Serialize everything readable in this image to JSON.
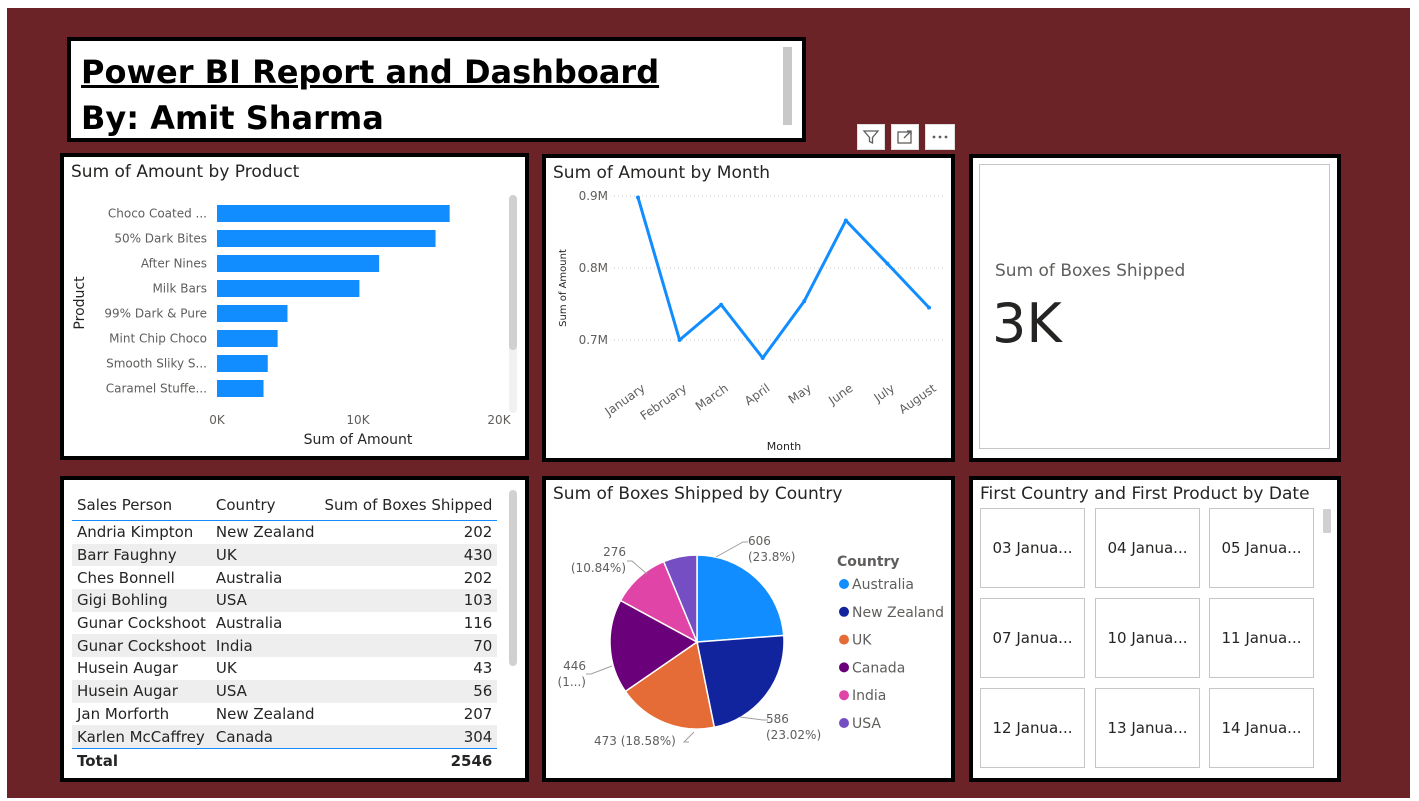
{
  "header": {
    "title_line1": "Power BI Report and Dashboard",
    "title_line2": "By: Amit Sharma"
  },
  "toolbar": {
    "icons": [
      "filter-icon",
      "focus-mode-icon",
      "more-options-icon"
    ]
  },
  "bar_chart": {
    "title": "Sum of Amount by Product",
    "chart_data": {
      "type": "bar",
      "orientation": "horizontal",
      "categories": [
        "Choco Coated ...",
        "50% Dark Bites",
        "After Nines",
        "Milk Bars",
        "99% Dark & Pure",
        "Mint Chip Choco",
        "Smooth Sliky S...",
        "Caramel Stuffe..."
      ],
      "values": [
        16500,
        15500,
        11500,
        10100,
        5000,
        4300,
        3600,
        3300
      ],
      "xlabel": "Sum of Amount",
      "ylabel": "Product",
      "xlim": [
        0,
        20000
      ],
      "xticks": [
        "0K",
        "10K",
        "20K"
      ],
      "color": "#118dff"
    }
  },
  "line_chart": {
    "title": "Sum of Amount by Month",
    "chart_data": {
      "type": "line",
      "x": [
        "January",
        "February",
        "March",
        "April",
        "May",
        "June",
        "July",
        "August"
      ],
      "values": [
        0.898,
        0.7,
        0.749,
        0.675,
        0.754,
        0.866,
        0.806,
        0.745
      ],
      "xlabel": "Month",
      "ylabel": "Sum of Amount",
      "ylim": [
        0.65,
        0.92
      ],
      "yticks": [
        {
          "v": 0.9,
          "label": "0.9M"
        },
        {
          "v": 0.8,
          "label": "0.8M"
        },
        {
          "v": 0.7,
          "label": "0.7M"
        }
      ],
      "grid": true,
      "color": "#118dff"
    }
  },
  "card": {
    "label": "Sum of Boxes Shipped",
    "value": "3K"
  },
  "table": {
    "headers": [
      "Sales Person",
      "Country",
      "Sum of Boxes Shipped"
    ],
    "rows": [
      [
        "Andria Kimpton",
        "New Zealand",
        "202"
      ],
      [
        "Barr Faughny",
        "UK",
        "430"
      ],
      [
        "Ches Bonnell",
        "Australia",
        "202"
      ],
      [
        "Gigi Bohling",
        "USA",
        "103"
      ],
      [
        "Gunar Cockshoot",
        "Australia",
        "116"
      ],
      [
        "Gunar Cockshoot",
        "India",
        "70"
      ],
      [
        "Husein Augar",
        "UK",
        "43"
      ],
      [
        "Husein Augar",
        "USA",
        "56"
      ],
      [
        "Jan Morforth",
        "New Zealand",
        "207"
      ],
      [
        "Karlen McCaffrey",
        "Canada",
        "304"
      ]
    ],
    "total_label": "Total",
    "total_value": "2546"
  },
  "pie_chart": {
    "title": "Sum of Boxes Shipped by Country",
    "legend_title": "Country",
    "chart_data": {
      "type": "pie",
      "legend_placement": "right",
      "slices": [
        {
          "name": "Australia",
          "value": 606,
          "color": "#118dff",
          "label1": "606",
          "label2": "(23.8%)"
        },
        {
          "name": "New Zealand",
          "value": 586,
          "color": "#12239e",
          "label1": "586",
          "label2": "(23.02%)"
        },
        {
          "name": "UK",
          "value": 473,
          "color": "#e66c37",
          "label1": "473 (18.58%)",
          "label2": ""
        },
        {
          "name": "Canada",
          "value": 446,
          "color": "#6b007b",
          "label1": "446",
          "label2": "(1...)"
        },
        {
          "name": "India",
          "value": 276,
          "color": "#e044a7",
          "label1": "276",
          "label2": "(10.84%)"
        },
        {
          "name": "USA",
          "value": 159,
          "color": "#744ec2",
          "label1": "",
          "label2": ""
        }
      ]
    }
  },
  "tiles": {
    "title": "First Country and First Product by Date",
    "items": [
      "03 Janua...",
      "04 Janua...",
      "05 Janua...",
      "07 Janua...",
      "10 Janua...",
      "11 Janua...",
      "12 Janua...",
      "13 Janua...",
      "14 Janua..."
    ]
  }
}
